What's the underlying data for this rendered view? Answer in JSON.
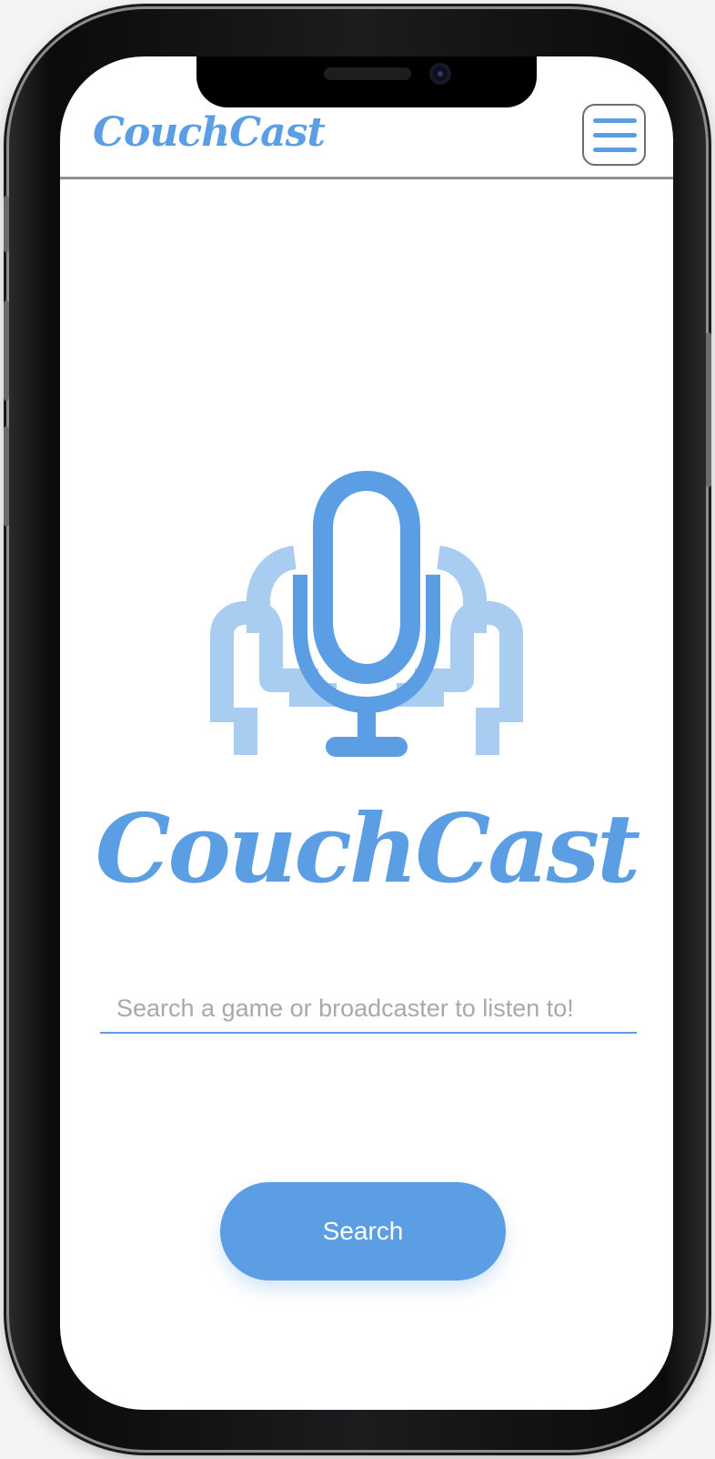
{
  "app": {
    "brand_name": "CouchCast"
  },
  "header": {
    "logo_text": "CouchCast",
    "menu_icon": "hamburger-menu-icon"
  },
  "hero": {
    "logo_icon": "microphone-on-couch-icon",
    "brand_text": "CouchCast"
  },
  "search": {
    "placeholder": "Search a game or broadcaster to listen to!",
    "value": "",
    "button_label": "Search"
  },
  "colors": {
    "accent": "#5b9ee3",
    "accent_light": "#a9cdf1",
    "background": "#ffffff"
  }
}
